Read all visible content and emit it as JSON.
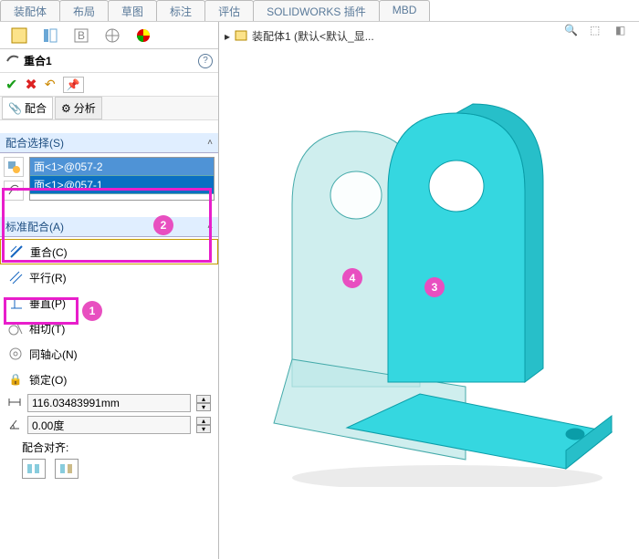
{
  "tabs": [
    "装配体",
    "布局",
    "草图",
    "标注",
    "评估",
    "SOLIDWORKS 插件",
    "MBD"
  ],
  "tree_label": "装配体1  (默认<默认_显...",
  "feature_name": "重合1",
  "sub_tabs": {
    "mate": "配合",
    "analyze": "分析"
  },
  "sections": {
    "sel": "配合选择(S)",
    "std": "标准配合(A)",
    "align": "配合对齐:"
  },
  "selections": [
    "面<1>@057-2",
    "面<1>@057-1"
  ],
  "mates": {
    "coincident": "重合(C)",
    "parallel": "平行(R)",
    "perpendicular": "垂直(P)",
    "tangent": "相切(T)",
    "concentric": "同轴心(N)",
    "lock": "锁定(O)"
  },
  "distance_value": "116.03483991mm",
  "angle_value": "0.00度",
  "callouts": {
    "c1": "1",
    "c2": "2",
    "c3": "3",
    "c4": "4"
  }
}
